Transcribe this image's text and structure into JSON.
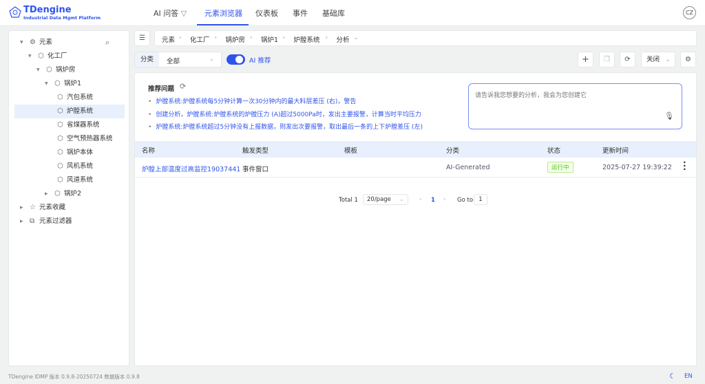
{
  "header": {
    "brand": "TDengine",
    "subtitle": "Industrial Data Mgmt Platform",
    "nav": [
      "AI 问答",
      "元素浏览器",
      "仪表板",
      "事件",
      "基础库"
    ],
    "active_nav": 1,
    "avatar": "CZ"
  },
  "tree": [
    {
      "label": "元素",
      "depth": 0,
      "arrow": "▼",
      "icon": "⚙"
    },
    {
      "label": "化工厂",
      "depth": 1,
      "arrow": "▼",
      "icon": "⬡"
    },
    {
      "label": "锅炉房",
      "depth": 2,
      "arrow": "▼",
      "icon": "⬡"
    },
    {
      "label": "锅炉1",
      "depth": 3,
      "arrow": "▼",
      "icon": "⬡"
    },
    {
      "label": "汽包系统",
      "depth": 4,
      "arrow": "",
      "icon": "⬡"
    },
    {
      "label": "炉膛系统",
      "depth": 4,
      "arrow": "",
      "icon": "⬡",
      "selected": true
    },
    {
      "label": "省煤器系统",
      "depth": 4,
      "arrow": "",
      "icon": "⬡"
    },
    {
      "label": "空气预热器系统",
      "depth": 4,
      "arrow": "",
      "icon": "⬡"
    },
    {
      "label": "锅炉本体",
      "depth": 4,
      "arrow": "",
      "icon": "⬡"
    },
    {
      "label": "风机系统",
      "depth": 4,
      "arrow": "",
      "icon": "⬡"
    },
    {
      "label": "风道系统",
      "depth": 4,
      "arrow": "",
      "icon": "⬡"
    },
    {
      "label": "锅炉2",
      "depth": 3,
      "arrow": "▶",
      "icon": "⬡"
    },
    {
      "label": "元素收藏",
      "depth": 0,
      "arrow": "▶",
      "icon": "☆"
    },
    {
      "label": "元素过滤器",
      "depth": 0,
      "arrow": "▶",
      "icon": "⧉"
    }
  ],
  "breadcrumb": [
    "元素",
    "化工厂",
    "锅炉房",
    "锅炉1",
    "炉膛系统",
    "分析"
  ],
  "toolbar": {
    "category_label": "分类",
    "category_value": "全部",
    "ai_label": "AI 推荐",
    "ai_on": true,
    "close_select": "关闭"
  },
  "recommend": {
    "title": "推荐问题",
    "items": [
      "炉膛系统:炉膛系统每5分钟计算一次30分钟内的最大料层差压 (右)，警告",
      "创建分析，炉膛系统:炉膛系统的炉膛压力 (A)超过5000Pa时，发出主要报警，计算当时平均压力",
      "炉膛系统:炉膛系统超过5分钟没有上报数据，则发出次要报警，取出最后一条的上下炉膛差压 (左)"
    ],
    "placeholder": "请告诉我您想要的分析，我会为您创建它"
  },
  "table": {
    "headers": [
      "名称",
      "触发类型",
      "模板",
      "分类",
      "状态",
      "更新时间"
    ],
    "rows": [
      {
        "name": "炉膛上部温度过高监控19037441",
        "trigger": "事件窗口",
        "template": "",
        "category": "AI-Generated",
        "status": "运行中",
        "updated": "2025-07-27 19:39:22"
      }
    ]
  },
  "pagination": {
    "total": "Total 1",
    "page_size": "20/page",
    "current": "1",
    "goto_label": "Go to",
    "goto_value": "1"
  },
  "footer": {
    "version": "TDengine IDMP 版本 0.9.8-20250724 数据版本 0.9.8",
    "lang": "EN"
  },
  "colors": {
    "accent": "#2f54eb",
    "status_green": "#52c41a"
  }
}
